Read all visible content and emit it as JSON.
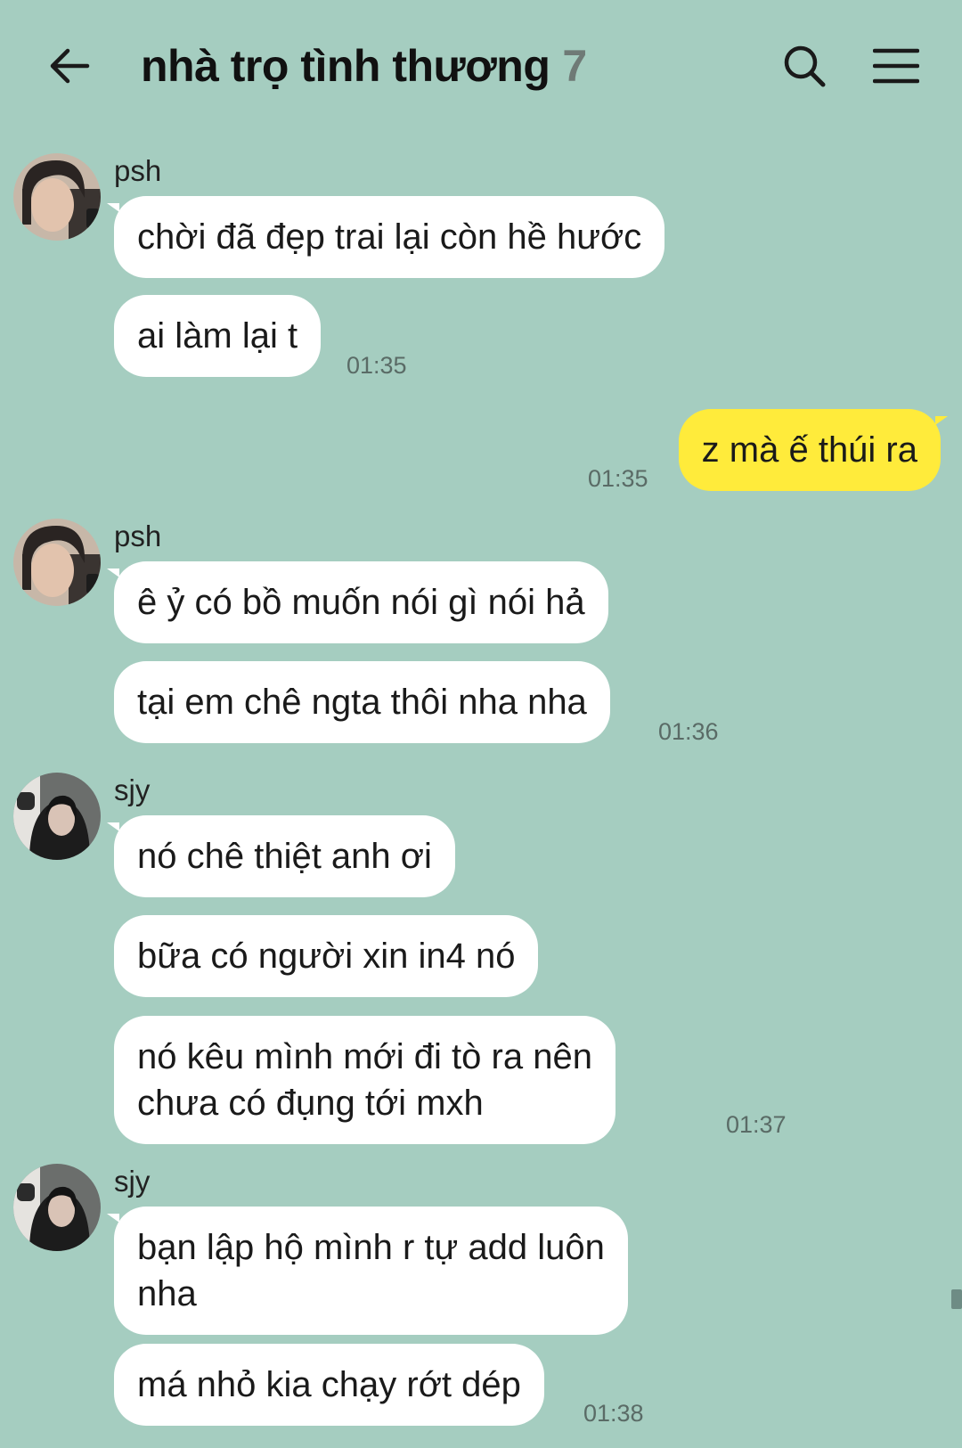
{
  "header": {
    "title": "nhà trọ tình thương",
    "member_count": "7",
    "back_icon": "arrow-left-icon",
    "search_icon": "search-icon",
    "menu_icon": "menu-icon"
  },
  "colors": {
    "background": "#a5cdc0",
    "bubble_other": "#ffffff",
    "bubble_mine": "#ffeb3b",
    "member_count": "#6f7a76",
    "timestamp": "#5a6b66"
  },
  "messages": [
    {
      "sender": "psh",
      "avatar": "avatar-psh",
      "bubbles": [
        "chời đã đẹp trai lại còn hề hước",
        "ai làm lại t"
      ],
      "time": "01:35"
    },
    {
      "sender": "me",
      "bubbles": [
        "z mà ế thúi ra"
      ],
      "time": "01:35"
    },
    {
      "sender": "psh",
      "avatar": "avatar-psh",
      "bubbles": [
        "ê ỷ có bồ muốn nói gì nói hả",
        "tại em chê ngta thôi nha nha"
      ],
      "time": "01:36"
    },
    {
      "sender": "sjy",
      "avatar": "avatar-sjy",
      "bubbles": [
        "nó chê thiệt anh ơi",
        "bữa có người xin in4 nó",
        "nó kêu mình mới đi tò ra nên\nchưa có đụng tới mxh"
      ],
      "time": "01:37"
    },
    {
      "sender": "sjy",
      "avatar": "avatar-sjy",
      "bubbles": [
        "bạn lập hộ mình r tự add luôn\nnha",
        "má nhỏ kia chạy rớt dép"
      ],
      "time": "01:38"
    }
  ]
}
